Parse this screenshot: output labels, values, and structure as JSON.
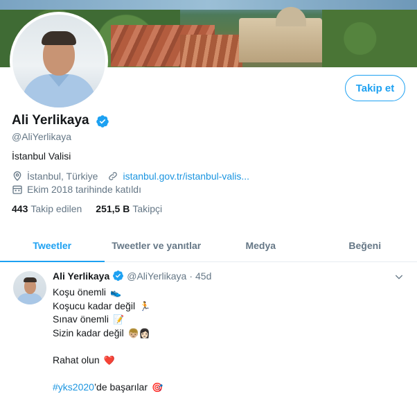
{
  "profile": {
    "name": "Ali Yerlikaya",
    "handle": "@AliYerlikaya",
    "bio": "İstanbul Valisi",
    "location": "İstanbul, Türkiye",
    "website": "istanbul.gov.tr/istanbul-valis...",
    "joined": "Ekim 2018 tarihinde katıldı",
    "following_count": "443",
    "following_label": "Takip edilen",
    "followers_count": "251,5 B",
    "followers_label": "Takipçi",
    "follow_button": "Takip et"
  },
  "tabs": [
    {
      "label": "Tweetler",
      "active": true
    },
    {
      "label": "Tweetler ve yanıtlar",
      "active": false
    },
    {
      "label": "Medya",
      "active": false
    },
    {
      "label": "Beğeni",
      "active": false
    }
  ],
  "tweet": {
    "name": "Ali Yerlikaya",
    "handle": "@AliYerlikaya",
    "dot": "·",
    "time": "45d",
    "lines": [
      {
        "text": "Koşu önemli",
        "emoji": "👟"
      },
      {
        "text": "Koşucu kadar değil",
        "emoji": "🏃"
      },
      {
        "text": "Sınav önemli",
        "emoji": "📝"
      },
      {
        "text": "Sizin kadar değil",
        "emoji": "👦🏼👩🏻"
      },
      {
        "text": "Rahat olun",
        "emoji": "❤️"
      },
      {
        "hashtag": "#yks2020",
        "text": "’de başarılar",
        "emoji": "🎯"
      }
    ]
  },
  "colors": {
    "accent": "#1da1f2",
    "link": "#1b95e0",
    "muted": "#657786",
    "text": "#14171a",
    "border": "#e6ecf0",
    "heart": "#e0245e"
  },
  "icons": {
    "verified": "verified-badge-icon",
    "location": "location-pin-icon",
    "link": "link-icon",
    "calendar": "calendar-icon",
    "caret": "chevron-down-icon"
  }
}
